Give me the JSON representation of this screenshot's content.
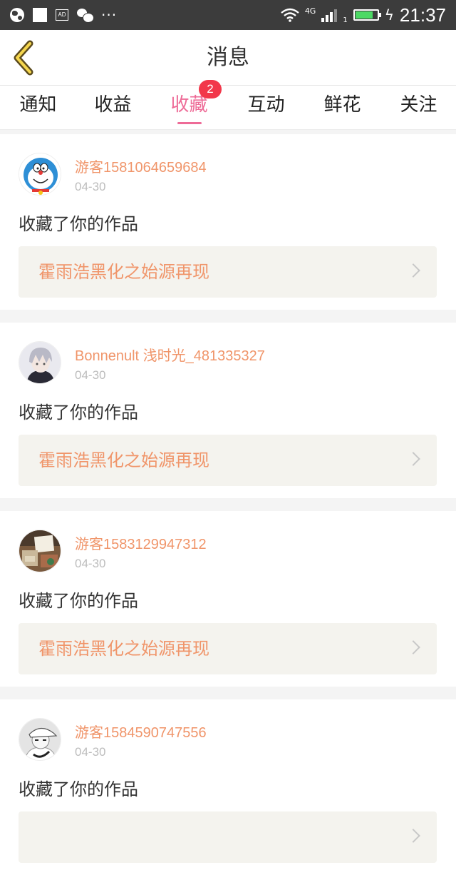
{
  "status_bar": {
    "ad_icon_text": "AD",
    "dots": "···",
    "network": "4G",
    "sim_slot": "1",
    "battery_level": 0.8,
    "time": "21:37"
  },
  "header": {
    "title": "消息"
  },
  "tabs": [
    {
      "label": "通知",
      "active": false
    },
    {
      "label": "收益",
      "active": false
    },
    {
      "label": "收藏",
      "active": true,
      "badge": "2"
    },
    {
      "label": "互动",
      "active": false
    },
    {
      "label": "鲜花",
      "active": false
    },
    {
      "label": "关注",
      "active": false
    }
  ],
  "colors": {
    "accent_pink": "#ee6b97",
    "badge_red": "#f2374a",
    "username_orange": "#f0956a",
    "work_bg": "#f4f3ee"
  },
  "messages": [
    {
      "username": "游客1581064659684",
      "date": "04-30",
      "action": "收藏了你的作品",
      "work_title": "霍雨浩黑化之始源再现",
      "avatar_icon": "doraemon-avatar-icon"
    },
    {
      "username": "Bonnenult 浅时光_481335327",
      "date": "04-30",
      "action": "收藏了你的作品",
      "work_title": "霍雨浩黑化之始源再现",
      "avatar_icon": "anime-boy-avatar-icon"
    },
    {
      "username": "游客1583129947312",
      "date": "04-30",
      "action": "收藏了你的作品",
      "work_title": "霍雨浩黑化之始源再现",
      "avatar_icon": "photo-avatar-icon"
    },
    {
      "username": "游客1584590747556",
      "date": "04-30",
      "action": "收藏了你的作品",
      "work_title": "",
      "avatar_icon": "cap-person-avatar-icon"
    }
  ]
}
